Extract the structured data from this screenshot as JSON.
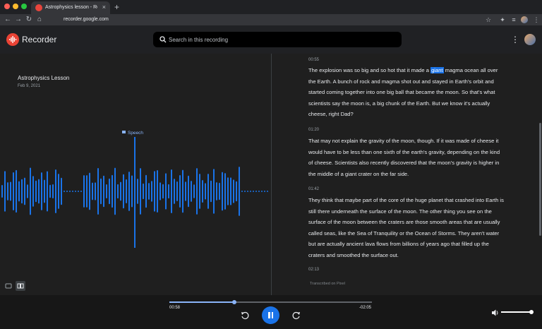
{
  "browser": {
    "tab_title": "Astrophysics lesson - Rec",
    "tab_close": "×",
    "new_tab": "+",
    "url": "recorder.google.com"
  },
  "app": {
    "name": "Recorder",
    "search_placeholder": "Search in this recording"
  },
  "recording": {
    "title": "Astrophysics Lesson",
    "date": "Feb 9, 2021",
    "speech_label": "Speech"
  },
  "transcript": [
    {
      "time": "00:55",
      "before": "The explosion was so big and so hot that it made a ",
      "highlight": "giant",
      "after": " magma ocean all over the Earth. A bunch of rock and magma shot out and stayed in Earth's orbit and started coming together into one big ball that became the moon. So that's what scientists say the moon is, a big chunk of the Earth. But we know it's actually cheese, right Dad?"
    },
    {
      "time": "01:20",
      "text": "That may not explain the gravity of the moon, though. If it was made of cheese it would have to be less than one sixth of the earth's gravity, depending on the kind of cheese. Scientists also recently discovered that the moon's gravity is higher in the middle of a giant crater on the far side."
    },
    {
      "time": "01:42",
      "text": "They think that maybe part of the core of the huge planet that crashed into Earth is still there underneath the surface of the moon. The other thing you see on the surface of the moon between the craters are those smooth areas that are usually called seas, like the Sea of Tranquility or the Ocean of Storms. They aren't water but are actually ancient lava flows from billions of years ago that filled up the craters and smoothed the surface out."
    },
    {
      "time": "02:13"
    }
  ],
  "transcribed_note": "Transcribed on Pixel",
  "player": {
    "elapsed": "00:58",
    "remaining": "-02:05",
    "progress": 0.32,
    "volume": 0.98
  },
  "colors": {
    "accent": "#1a73e8",
    "waveform": "#1a73e8",
    "brand_red": "#ea4335"
  },
  "icons": [
    "record-icon",
    "search-icon",
    "more-vert-icon",
    "speech-icon",
    "rewind-icon",
    "pause-icon",
    "forward-icon",
    "volume-icon"
  ]
}
